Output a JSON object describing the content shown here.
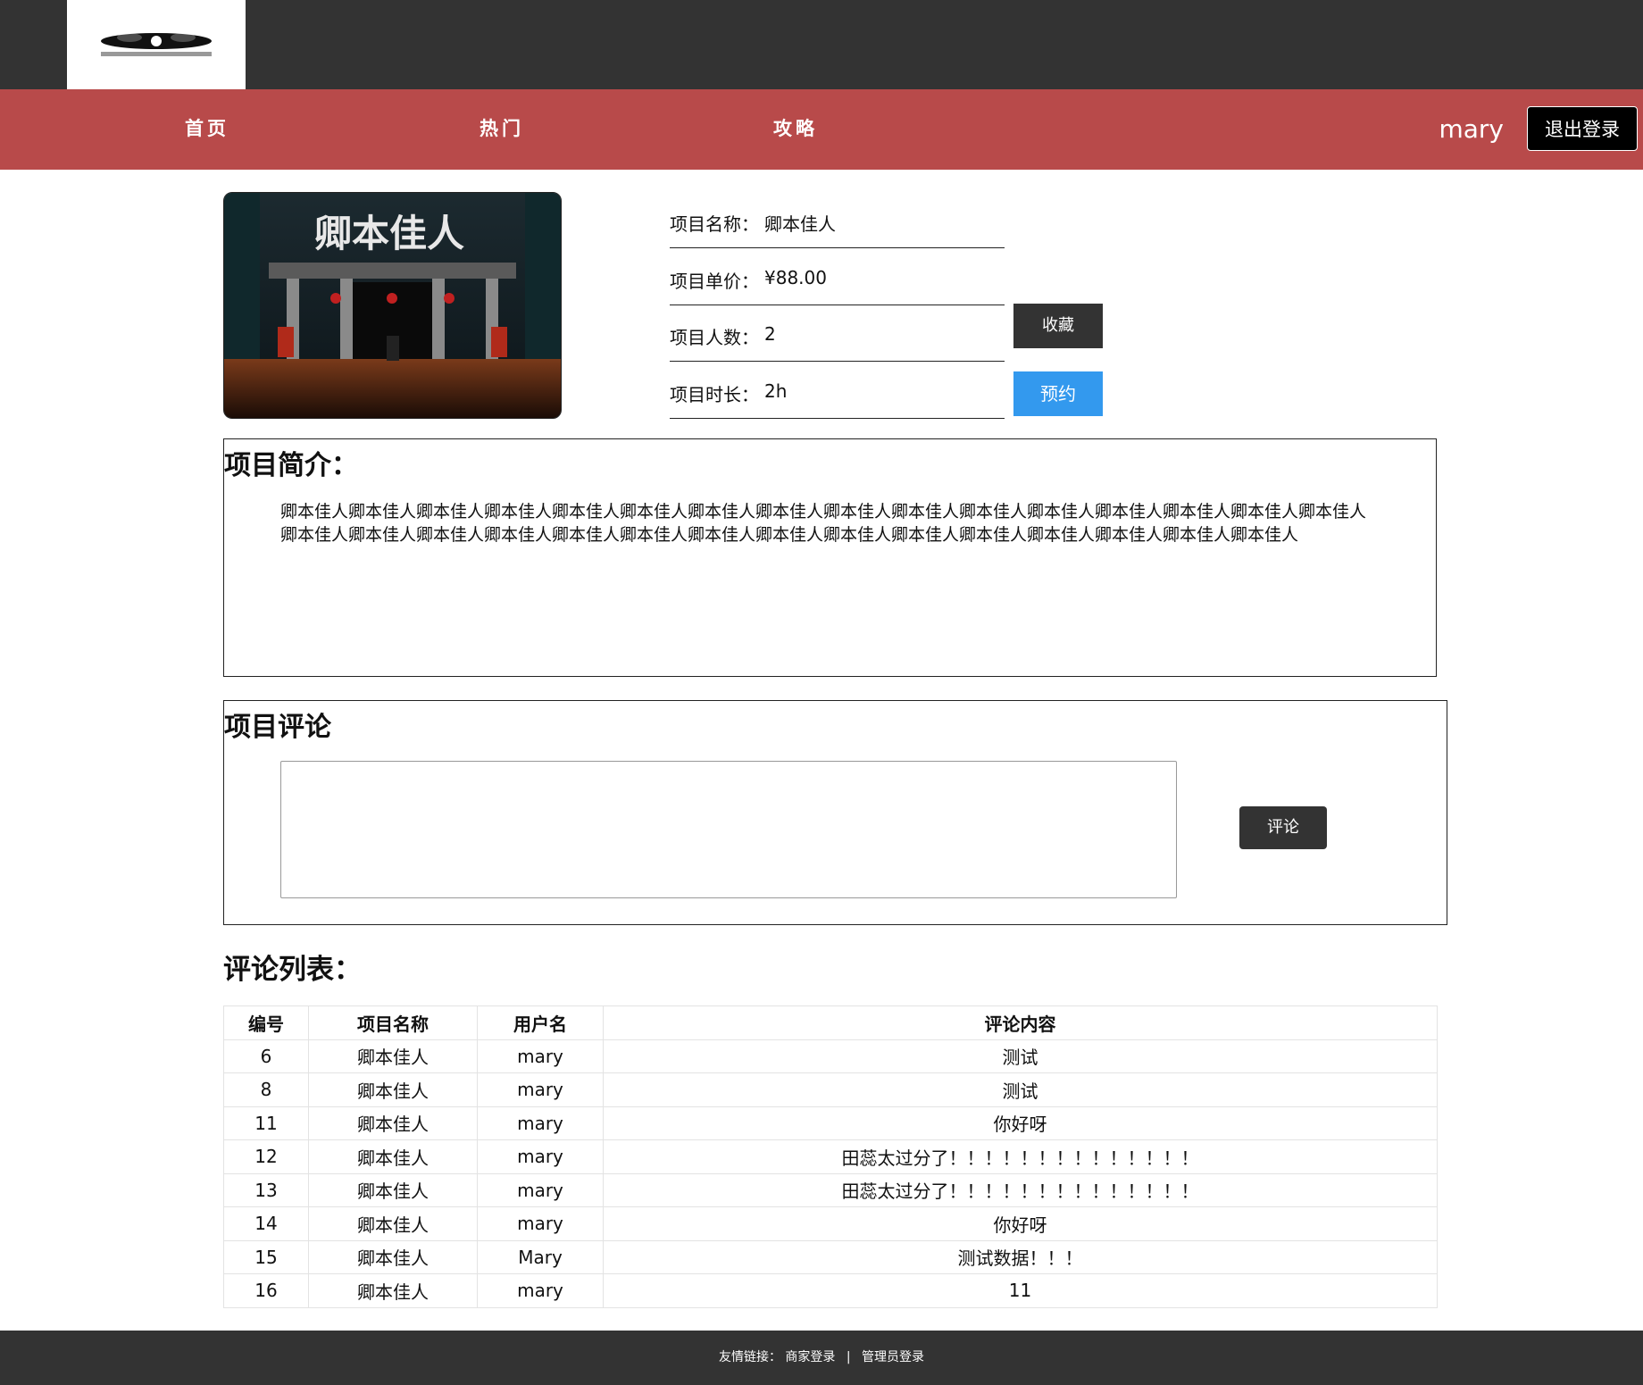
{
  "nav": {
    "items": [
      {
        "label": "首页"
      },
      {
        "label": "热门"
      },
      {
        "label": "攻略"
      }
    ],
    "username": "mary",
    "logout_label": "退出登录"
  },
  "project": {
    "name_label": "项目名称：",
    "name": "卿本佳人",
    "price_label": "项目单价：",
    "price": "¥88.00",
    "people_label": "项目人数：",
    "people": "2",
    "duration_label": "项目时长：",
    "duration": "2h",
    "favorite_label": "收藏",
    "book_label": "预约"
  },
  "intro": {
    "title": "项目简介：",
    "text": "卿本佳人卿本佳人卿本佳人卿本佳人卿本佳人卿本佳人卿本佳人卿本佳人卿本佳人卿本佳人卿本佳人卿本佳人卿本佳人卿本佳人卿本佳人卿本佳人卿本佳人卿本佳人卿本佳人卿本佳人卿本佳人卿本佳人卿本佳人卿本佳人卿本佳人卿本佳人卿本佳人卿本佳人卿本佳人卿本佳人卿本佳人"
  },
  "comment_form": {
    "title": "项目评论",
    "textarea_value": "",
    "submit_label": "评论"
  },
  "comment_list": {
    "title": "评论列表：",
    "headers": [
      "编号",
      "项目名称",
      "用户名",
      "评论内容"
    ],
    "rows": [
      [
        "6",
        "卿本佳人",
        "mary",
        "测试"
      ],
      [
        "8",
        "卿本佳人",
        "mary",
        "测试"
      ],
      [
        "11",
        "卿本佳人",
        "mary",
        "你好呀"
      ],
      [
        "12",
        "卿本佳人",
        "mary",
        "田蕊太过分了！！！！！！！！！！！！！！"
      ],
      [
        "13",
        "卿本佳人",
        "mary",
        "田蕊太过分了！！！！！！！！！！！！！！"
      ],
      [
        "14",
        "卿本佳人",
        "mary",
        "你好呀"
      ],
      [
        "15",
        "卿本佳人",
        "Mary",
        "测试数据！！！"
      ],
      [
        "16",
        "卿本佳人",
        "mary",
        "11"
      ]
    ]
  },
  "footer": {
    "prefix": "友情链接：",
    "merchant_login": "商家登录",
    "separator": "|",
    "admin_login": "管理员登录"
  }
}
